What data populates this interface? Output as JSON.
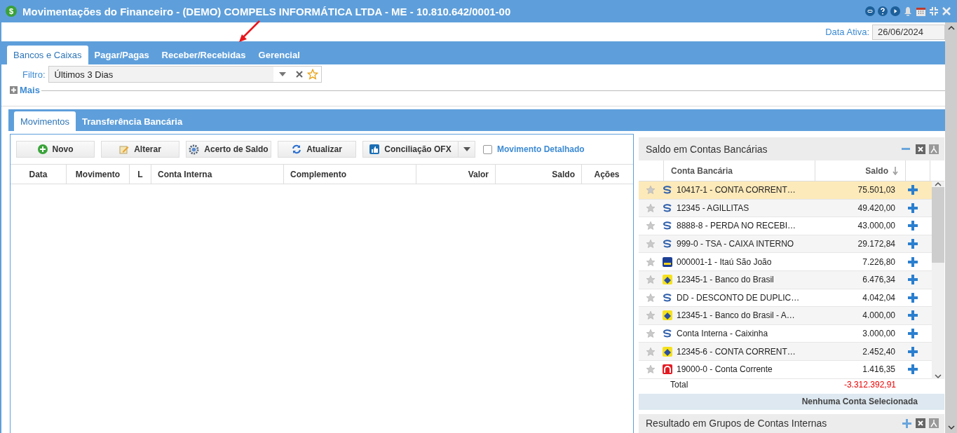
{
  "window": {
    "icon": "$",
    "title": "Movimentações do Financeiro - (DEMO) COMPELS INFORMÁTICA LTDA - ME - 10.810.642/0001-00"
  },
  "active_date": {
    "label": "Data Ativa:",
    "value": "26/06/2024"
  },
  "tabs": [
    {
      "label": "Bancos e Caixas",
      "selected": true
    },
    {
      "label": "Pagar/Pagas",
      "selected": false
    },
    {
      "label": "Receber/Recebidas",
      "selected": false
    },
    {
      "label": "Gerencial",
      "selected": false
    }
  ],
  "filter": {
    "label": "Filtro:",
    "value": "Últimos 3 Dias"
  },
  "more": {
    "label": "Mais"
  },
  "sub_tabs": [
    {
      "label": "Movimentos",
      "selected": true
    },
    {
      "label": "Transferência Bancária",
      "selected": false
    }
  ],
  "toolbar": [
    {
      "kind": "add",
      "label": "Novo"
    },
    {
      "kind": "edit",
      "label": "Alterar"
    },
    {
      "kind": "gear",
      "label": "Acerto de Saldo"
    },
    {
      "kind": "refresh",
      "label": "Atualizar"
    },
    {
      "kind": "split",
      "label": "Conciliação OFX"
    }
  ],
  "detailed": {
    "label": "Movimento Detalhado",
    "checked": false
  },
  "table": {
    "columns": [
      "Data",
      "Movimento",
      "L",
      "Conta Interna",
      "Complemento",
      "Valor",
      "Saldo",
      "Ações"
    ]
  },
  "balances": {
    "title": "Saldo em Contas Bancárias",
    "columns": [
      "Conta Bancária",
      "Saldo"
    ],
    "rows": [
      {
        "kind": "swirl",
        "account": "10417-1 - CONTA CORRENT…",
        "balance": "75.501,03",
        "selected": true
      },
      {
        "kind": "swirl",
        "account": "12345 - AGILLITAS",
        "balance": "49.420,00",
        "selected": false
      },
      {
        "kind": "swirl",
        "account": "8888-8 - PERDA NO RECEBI…",
        "balance": "43.000,00",
        "selected": false
      },
      {
        "kind": "swirl",
        "account": "999-0 - TSA - CAIXA INTERNO",
        "balance": "29.172,84",
        "selected": false
      },
      {
        "kind": "itau",
        "account": "000001-1 - Itaú São João",
        "balance": "7.226,80",
        "selected": false
      },
      {
        "kind": "bb",
        "account": "12345-1 - Banco do Brasil",
        "balance": "6.476,34",
        "selected": false
      },
      {
        "kind": "swirl",
        "account": "DD - DESCONTO DE DUPLIC…",
        "balance": "4.042,04",
        "selected": false
      },
      {
        "kind": "bb",
        "account": "12345-1 - Banco do Brasil - A…",
        "balance": "4.000,00",
        "selected": false
      },
      {
        "kind": "swirl",
        "account": "Conta Interna - Caixinha",
        "balance": "3.000,00",
        "selected": false
      },
      {
        "kind": "bb",
        "account": "12345-6 - CONTA CORRENT…",
        "balance": "2.452,40",
        "selected": false
      },
      {
        "kind": "red",
        "account": "19000-0 - Conta Corrente",
        "balance": "1.416,35",
        "selected": false
      }
    ],
    "total_label": "Total",
    "total": "-3.312.392,91",
    "status": "Nenhuma Conta Selecionada"
  },
  "groups": {
    "title": "Resultado em Grupos de Contas Internas"
  }
}
